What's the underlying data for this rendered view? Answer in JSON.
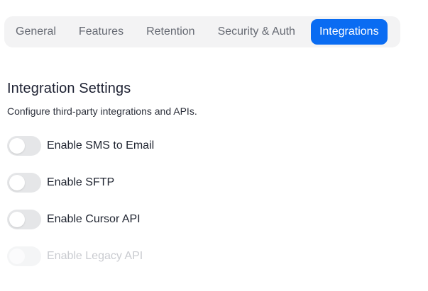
{
  "tabs": [
    {
      "label": "General",
      "active": false
    },
    {
      "label": "Features",
      "active": false
    },
    {
      "label": "Retention",
      "active": false
    },
    {
      "label": "Security & Auth",
      "active": false
    },
    {
      "label": "Integrations",
      "active": true
    }
  ],
  "section": {
    "title": "Integration Settings",
    "description": "Configure third-party integrations and APIs."
  },
  "toggles": [
    {
      "label": "Enable SMS to Email",
      "checked": false,
      "disabled": false
    },
    {
      "label": "Enable SFTP",
      "checked": false,
      "disabled": false
    },
    {
      "label": "Enable Cursor API",
      "checked": false,
      "disabled": false
    },
    {
      "label": "Enable Legacy API",
      "checked": false,
      "disabled": true
    }
  ],
  "colors": {
    "accent": "#0a6cf2",
    "tab_bg": "#f3f3f4",
    "toggle_off": "#e5e6e8",
    "disabled_text": "#c9cbd0"
  }
}
